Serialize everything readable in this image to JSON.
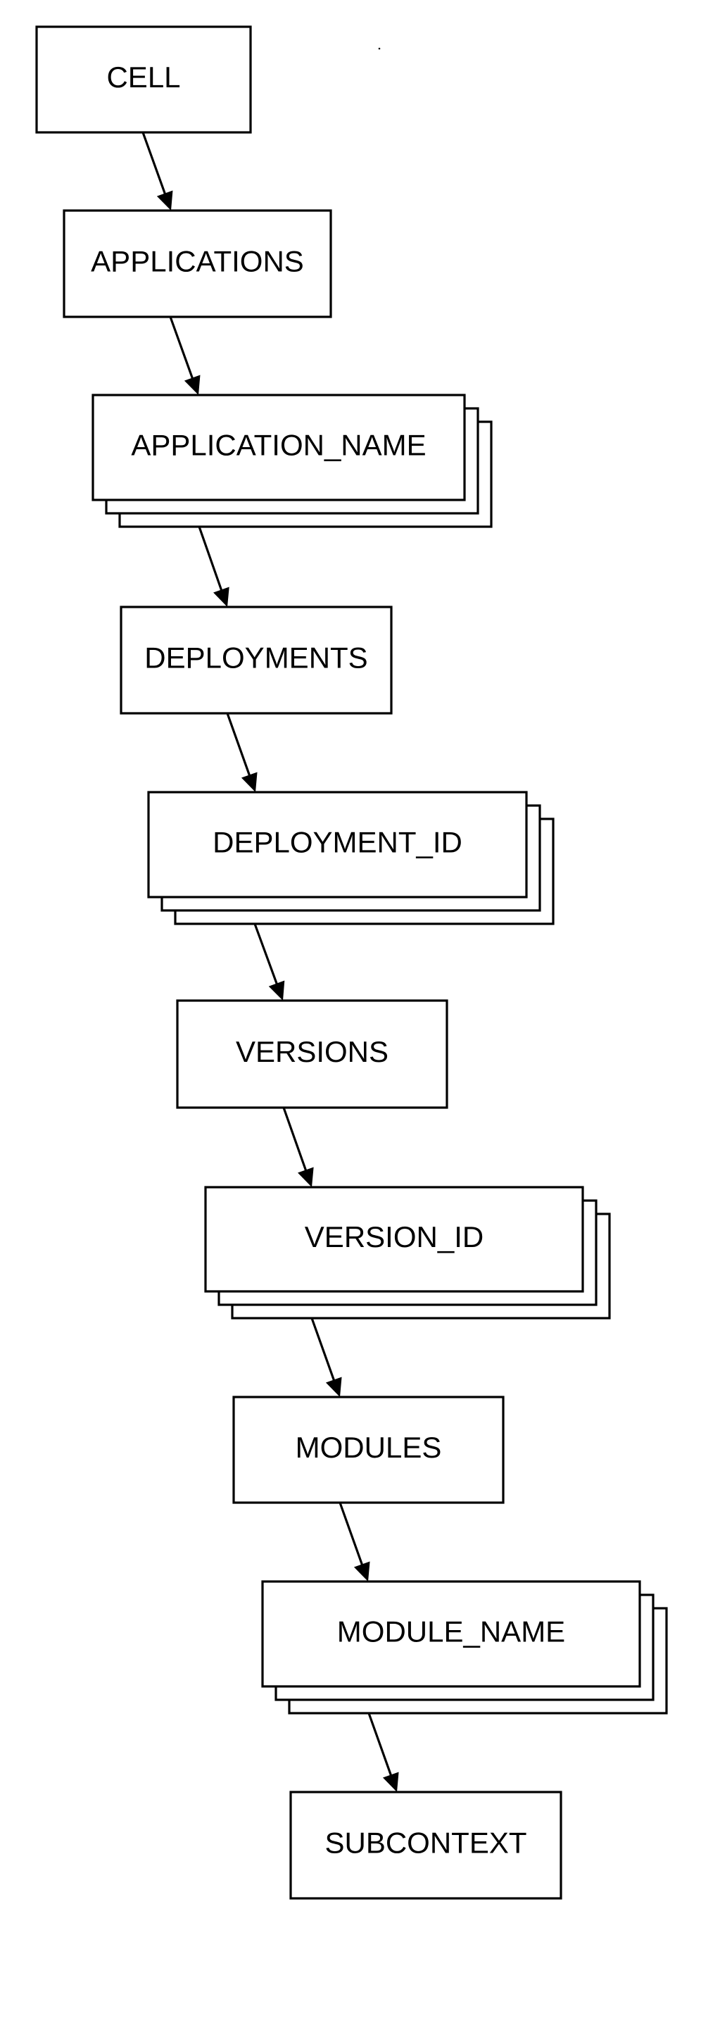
{
  "diagram": {
    "type": "hierarchy",
    "nodes": [
      {
        "id": "cell",
        "label": "CELL",
        "multiple": false
      },
      {
        "id": "applications",
        "label": "APPLICATIONS",
        "multiple": false
      },
      {
        "id": "application-name",
        "label": "APPLICATION_NAME",
        "multiple": true
      },
      {
        "id": "deployments",
        "label": "DEPLOYMENTS",
        "multiple": false
      },
      {
        "id": "deployment-id",
        "label": "DEPLOYMENT_ID",
        "multiple": true
      },
      {
        "id": "versions",
        "label": "VERSIONS",
        "multiple": false
      },
      {
        "id": "version-id",
        "label": "VERSION_ID",
        "multiple": true
      },
      {
        "id": "modules",
        "label": "MODULES",
        "multiple": false
      },
      {
        "id": "module-name",
        "label": "MODULE_NAME",
        "multiple": true
      },
      {
        "id": "subcontext",
        "label": "SUBCONTEXT",
        "multiple": false
      }
    ],
    "edges": [
      {
        "from": "cell",
        "to": "applications"
      },
      {
        "from": "applications",
        "to": "application-name"
      },
      {
        "from": "application-name",
        "to": "deployments"
      },
      {
        "from": "deployments",
        "to": "deployment-id"
      },
      {
        "from": "deployment-id",
        "to": "versions"
      },
      {
        "from": "versions",
        "to": "version-id"
      },
      {
        "from": "version-id",
        "to": "modules"
      },
      {
        "from": "modules",
        "to": "module-name"
      },
      {
        "from": "module-name",
        "to": "subcontext"
      }
    ],
    "colors": {
      "stroke": "#000000",
      "fill": "#ffffff",
      "text": "#000000"
    }
  }
}
